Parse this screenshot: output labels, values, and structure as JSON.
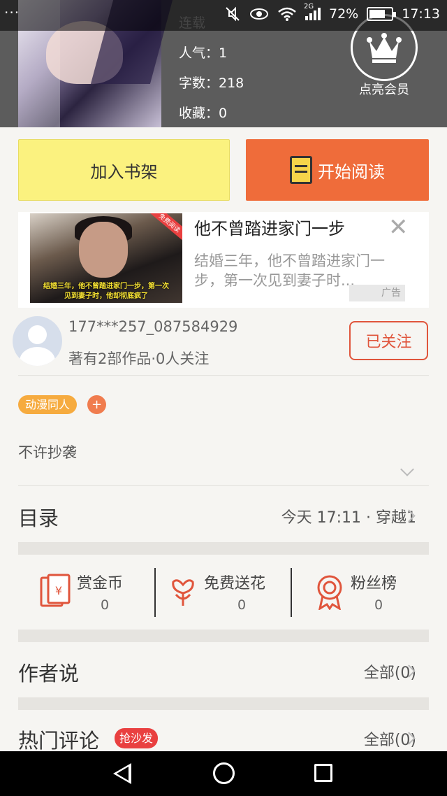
{
  "statusbar": {
    "menu": "···",
    "network": "2G",
    "battery_text": "72%",
    "battery_level": 0.72,
    "time": "17:13"
  },
  "book": {
    "status": "连载",
    "popularity": "人气：1",
    "word_count": "字数：218",
    "favorites": "收藏：0"
  },
  "vip": {
    "label": "点亮会员"
  },
  "actions": {
    "add_shelf": "加入书架",
    "start_read": "开始阅读"
  },
  "ad": {
    "title": "他不曾踏进家门一步",
    "desc": "结婚三年，他不曾踏进家门一步，第一次见到妻子时...",
    "image_caption_1": "结婚三年，他不曾踏进家门一步，第一次",
    "image_caption_2": "见到妻子时，他却彻底疯了",
    "image_tag": "免费阅读",
    "badge": "广告"
  },
  "author": {
    "name": "177***257_087584929",
    "meta": "著有2部作品·0人关注",
    "follow": "已关注"
  },
  "tags": [
    "动漫同人"
  ],
  "tag_add": "+",
  "description": "不许抄袭",
  "catalog": {
    "title": "目录",
    "latest": "今天 17:11 · 穿越1"
  },
  "stats": [
    {
      "label": "赏金币",
      "value": "0",
      "icon": "red-envelope-icon"
    },
    {
      "label": "免费送花",
      "value": "0",
      "icon": "flower-icon"
    },
    {
      "label": "粉丝榜",
      "value": "0",
      "icon": "medal-icon"
    }
  ],
  "author_says": {
    "title": "作者说",
    "all": "全部(0)"
  },
  "hot_comments": {
    "title": "热门评论",
    "badge": "抢沙发",
    "all": "全部(0)"
  },
  "colors": {
    "accent": "#ef6c3a",
    "shelf": "#fbf27f",
    "follow": "#e0553c",
    "tag": "#f6ab3f",
    "badge": "#e94040"
  }
}
